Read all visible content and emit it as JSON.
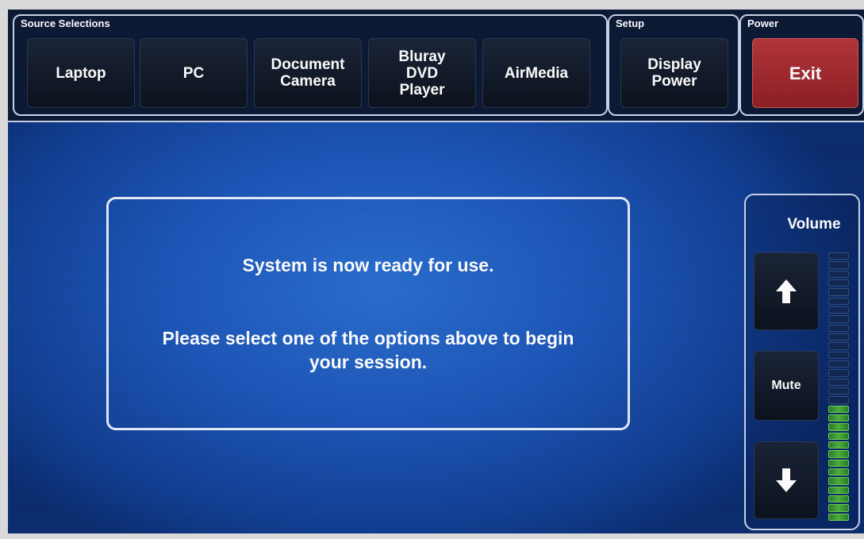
{
  "source_selections": {
    "label": "Source Selections",
    "buttons": [
      {
        "label": "Laptop"
      },
      {
        "label": "PC"
      },
      {
        "label": "Document\nCamera"
      },
      {
        "label": "Bluray\nDVD\nPlayer"
      },
      {
        "label": "AirMedia"
      }
    ]
  },
  "setup": {
    "label": "Setup",
    "display_power_label": "Display\nPower"
  },
  "power": {
    "label": "Power",
    "exit_label": "Exit"
  },
  "message": {
    "ready": "System is now ready for use.",
    "instruction": "Please select one of the options above to begin your session."
  },
  "volume": {
    "title": "Volume",
    "mute_label": "Mute",
    "up_icon": "arrow-up-icon",
    "down_icon": "arrow-down-icon",
    "level_fraction": 0.42
  },
  "colors": {
    "background_blue": "#1d56b8",
    "exit_red": "#a52a30",
    "meter_green": "#4cb23d"
  }
}
